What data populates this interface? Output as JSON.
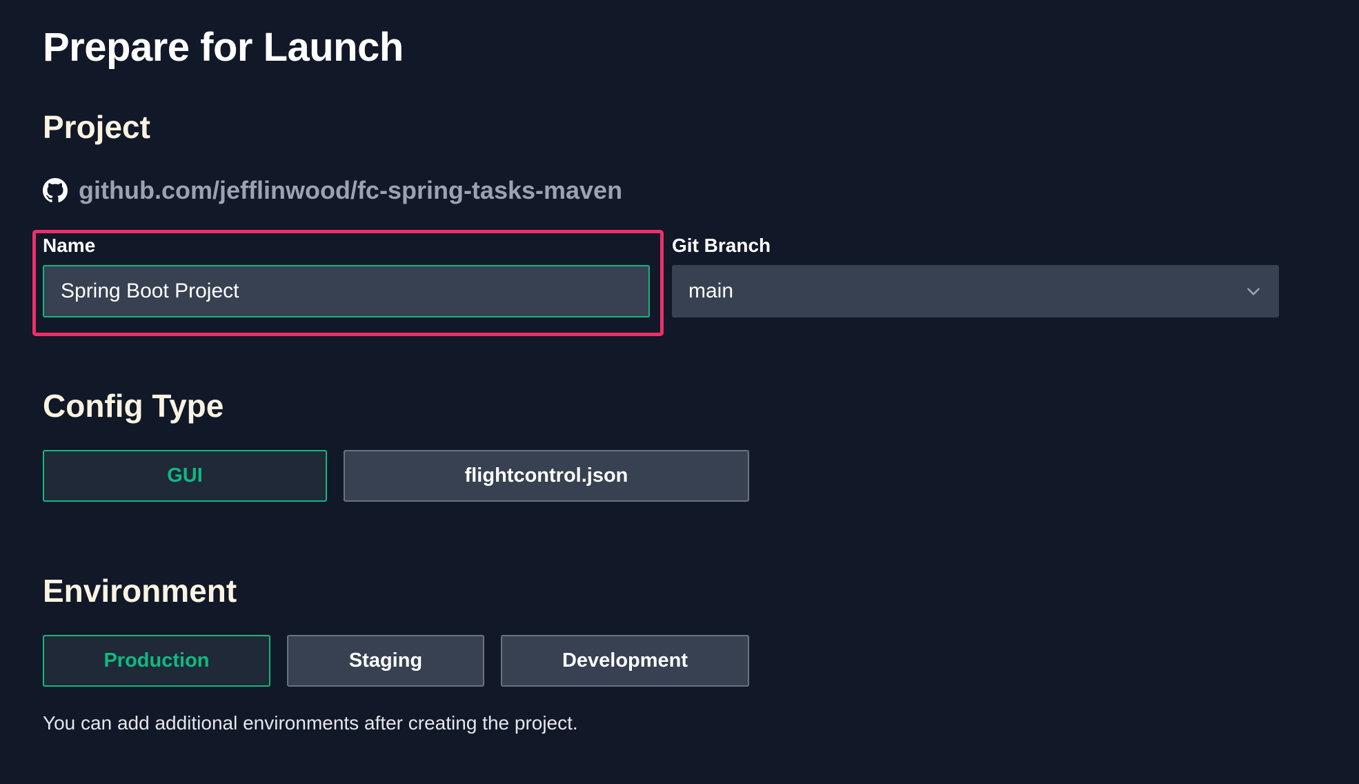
{
  "page": {
    "title": "Prepare for Launch"
  },
  "project": {
    "heading": "Project",
    "repo": {
      "icon": "github-icon",
      "text": "github.com/jefflinwood/fc-spring-tasks-maven"
    },
    "name_field": {
      "label": "Name",
      "value": "Spring Boot Project"
    },
    "branch_field": {
      "label": "Git Branch",
      "value": "main",
      "icon": "chevron-down-icon"
    }
  },
  "config_type": {
    "heading": "Config Type",
    "options": [
      {
        "label": "GUI",
        "selected": true
      },
      {
        "label": "flightcontrol.json",
        "selected": false
      }
    ]
  },
  "environment": {
    "heading": "Environment",
    "options": [
      {
        "label": "Production",
        "selected": true
      },
      {
        "label": "Staging",
        "selected": false
      },
      {
        "label": "Development",
        "selected": false
      }
    ],
    "helper_text": "You can add additional environments after creating the project."
  },
  "colors": {
    "background": "#111827",
    "accent": "#10b981",
    "highlight": "#ec2f6b",
    "input_bg": "#374151"
  }
}
